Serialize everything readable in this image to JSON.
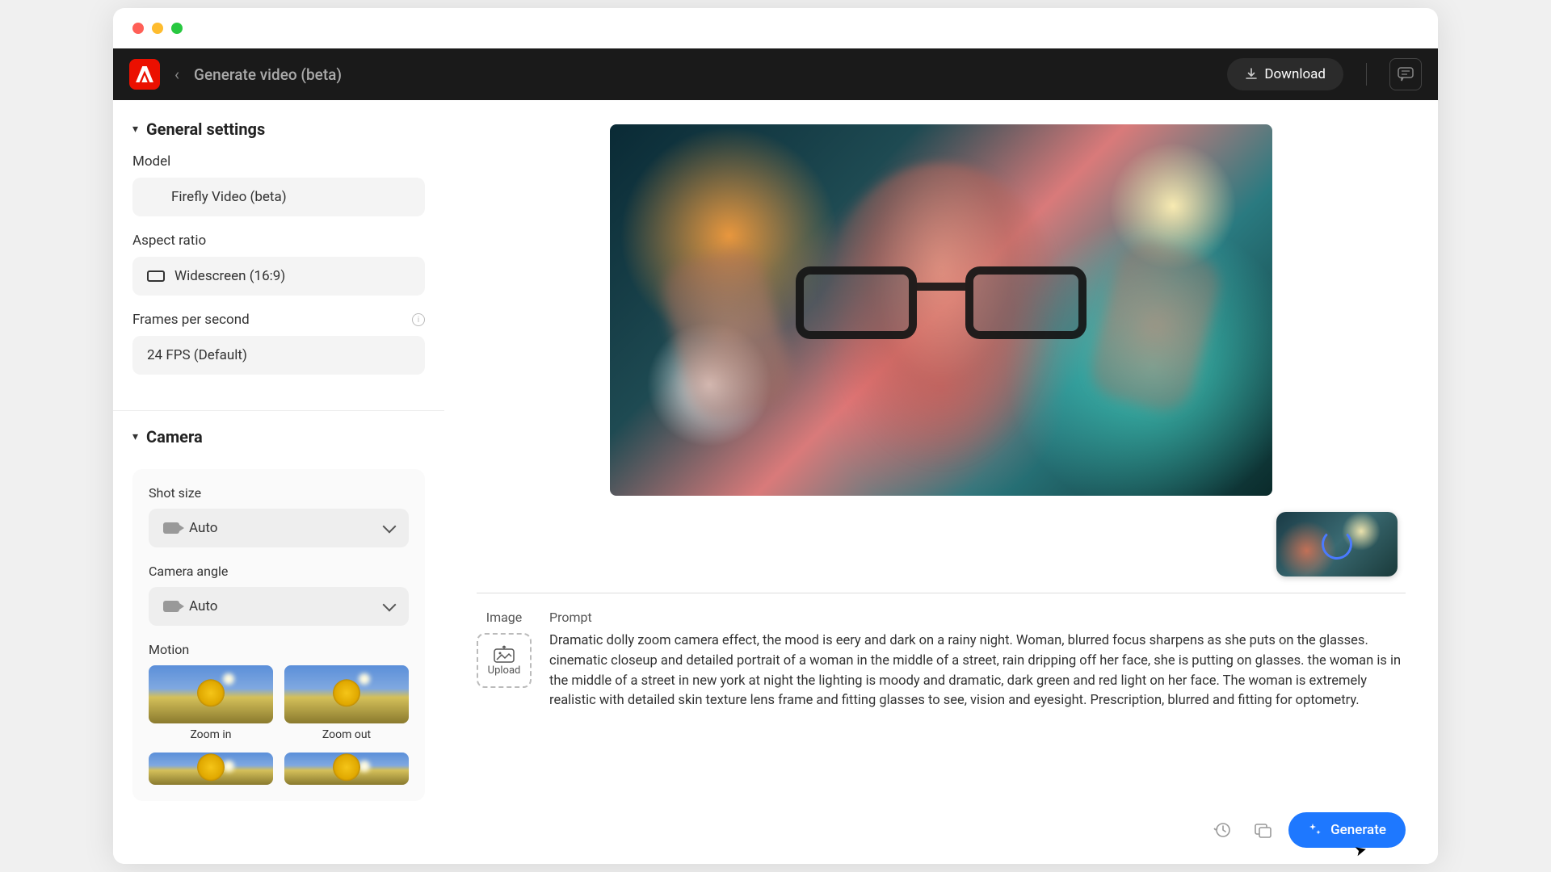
{
  "header": {
    "title": "Generate video (beta)",
    "download_label": "Download"
  },
  "sidebar": {
    "general": {
      "title": "General settings",
      "model_label": "Model",
      "model_value": "Firefly Video (beta)",
      "aspect_label": "Aspect ratio",
      "aspect_value": "Widescreen (16:9)",
      "fps_label": "Frames per second",
      "fps_value": "24 FPS (Default)"
    },
    "camera": {
      "title": "Camera",
      "shot_label": "Shot size",
      "shot_value": "Auto",
      "angle_label": "Camera angle",
      "angle_value": "Auto",
      "motion_label": "Motion",
      "motion_items": [
        "Zoom in",
        "Zoom out"
      ]
    }
  },
  "prompt_area": {
    "image_label": "Image",
    "upload_label": "Upload",
    "prompt_label": "Prompt",
    "prompt_text": "Dramatic dolly zoom camera effect, the mood is eery and dark on a rainy night. Woman, blurred focus sharpens as she puts on the glasses. cinematic closeup and detailed portrait of a woman in the middle of a street, rain dripping off her face, she is putting on glasses. the woman is in the middle of a street in new york at night the lighting is moody and dramatic, dark green and red light on her face. The woman is extremely realistic with detailed skin texture lens frame and fitting glasses to see, vision and eyesight. Prescription, blurred and fitting for optometry."
  },
  "actions": {
    "generate_label": "Generate"
  },
  "colors": {
    "accent": "#1e78ff",
    "brand": "#eb1000"
  }
}
